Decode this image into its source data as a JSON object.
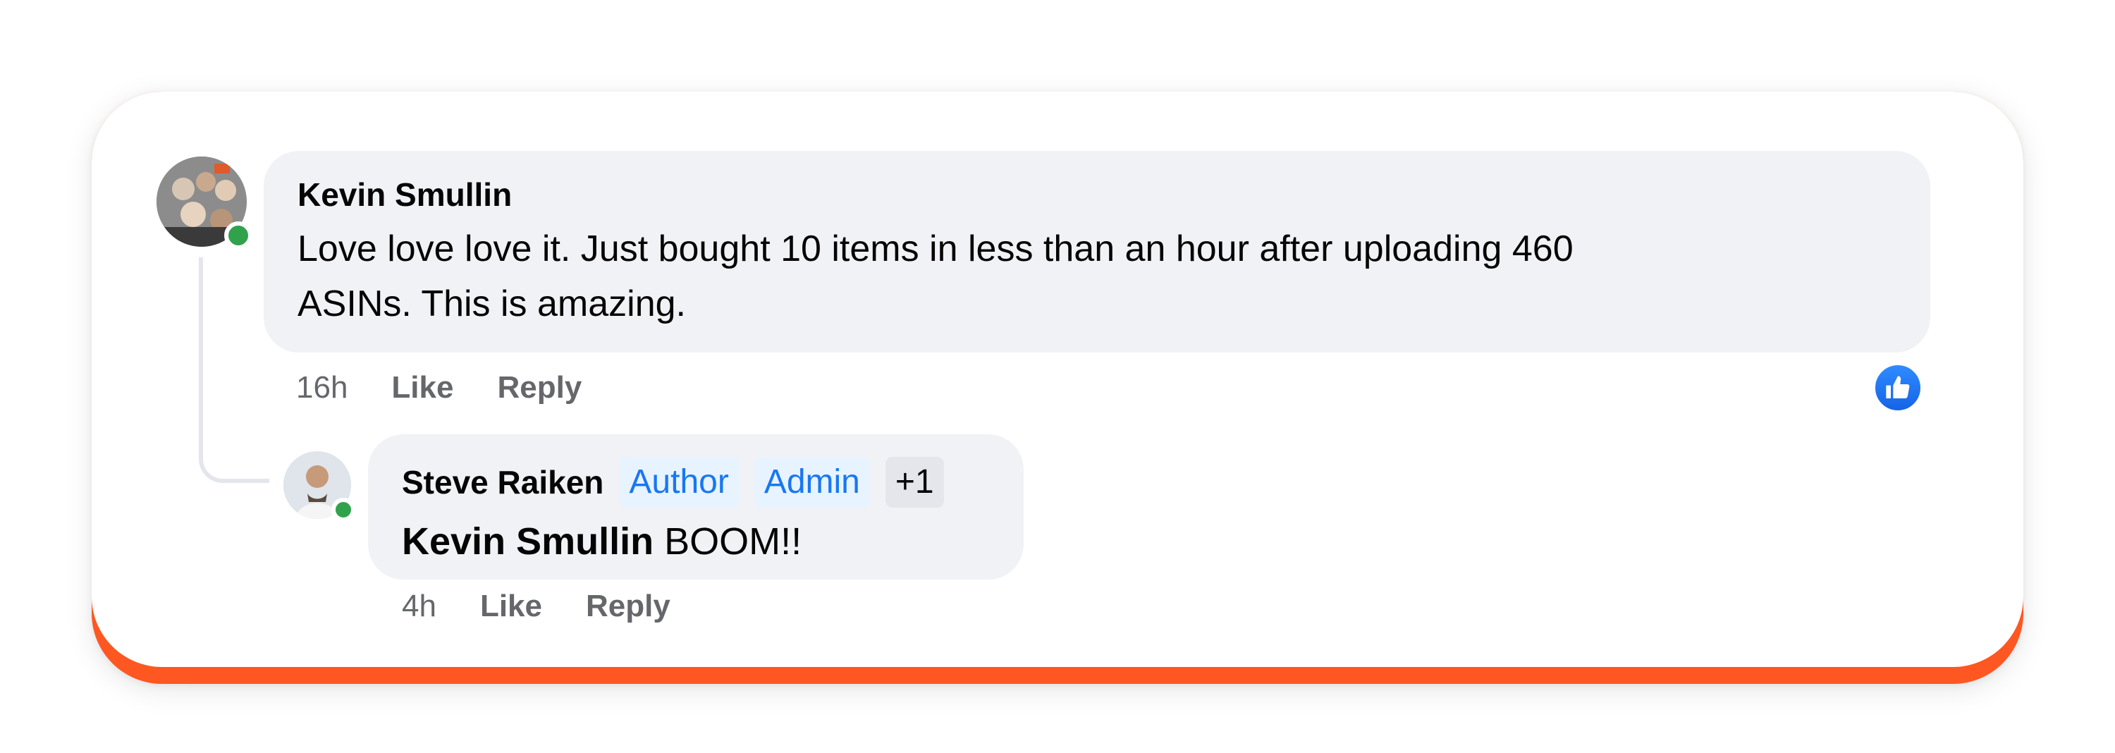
{
  "comments": [
    {
      "author": "Kevin Smullin",
      "text": "Love love love it. Just bought 10 items in less than an hour after uploading 460\nASINs. This is amazing.",
      "time": "16h",
      "like_label": "Like",
      "reply_label": "Reply",
      "online": true,
      "reaction_icon": "thumbs-up-icon"
    }
  ],
  "reply": {
    "author": "Steve Raiken",
    "badges": [
      "Author",
      "Admin"
    ],
    "badge_more": "+1",
    "mention": "Kevin Smullin",
    "text": " BOOM!!",
    "time": "4h",
    "like_label": "Like",
    "reply_label": "Reply",
    "online": true
  },
  "colors": {
    "accent_bottom": "#ff5722",
    "bubble_bg": "#f0f2f5",
    "badge_blue": "#1877f2",
    "online_green": "#31a24c",
    "reaction_blue": "#1877f2"
  }
}
